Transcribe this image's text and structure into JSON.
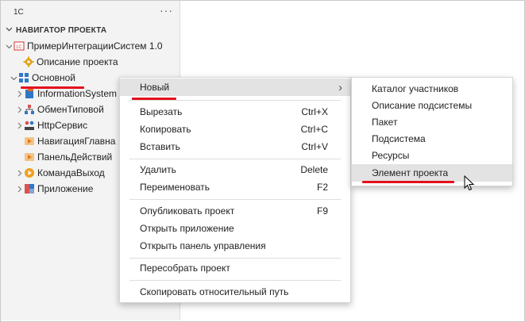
{
  "sidebar": {
    "header": "1C",
    "more": "···",
    "section_title": "НАВИГАТОР ПРОЕКТА",
    "tree": [
      {
        "label": "ПримерИнтеграцииСистем 1.0",
        "icon": "project-icon"
      },
      {
        "label": "Описание проекта",
        "icon": "gear-icon"
      },
      {
        "label": "Основной",
        "icon": "subsystem-grid-icon"
      },
      {
        "label": "InformationSystem",
        "icon": "information-system-icon"
      },
      {
        "label": "ОбменТиповой",
        "icon": "exchange-icon"
      },
      {
        "label": "HttpСервис",
        "icon": "http-service-icon"
      },
      {
        "label": "НавигацияГлавна",
        "icon": "navigation-icon"
      },
      {
        "label": "ПанельДействий",
        "icon": "action-panel-icon"
      },
      {
        "label": "КомандаВыход",
        "icon": "command-icon"
      },
      {
        "label": "Приложение",
        "icon": "application-icon"
      }
    ]
  },
  "context_menu": {
    "items": [
      {
        "label": "Новый",
        "shortcut": "›"
      },
      {
        "label": "Вырезать",
        "shortcut": "Ctrl+X"
      },
      {
        "label": "Копировать",
        "shortcut": "Ctrl+C"
      },
      {
        "label": "Вставить",
        "shortcut": "Ctrl+V"
      },
      {
        "label": "Удалить",
        "shortcut": "Delete"
      },
      {
        "label": "Переименовать",
        "shortcut": "F2"
      },
      {
        "label": "Опубликовать проект",
        "shortcut": "F9"
      },
      {
        "label": "Открыть приложение",
        "shortcut": ""
      },
      {
        "label": "Открыть панель управления",
        "shortcut": ""
      },
      {
        "label": "Пересобрать проект",
        "shortcut": ""
      },
      {
        "label": "Скопировать относительный путь",
        "shortcut": ""
      }
    ]
  },
  "submenu": {
    "items": [
      {
        "label": "Каталог участников"
      },
      {
        "label": "Описание подсистемы"
      },
      {
        "label": "Пакет"
      },
      {
        "label": "Подсистема"
      },
      {
        "label": "Ресурсы"
      },
      {
        "label": "Элемент проекта"
      }
    ]
  },
  "colors": {
    "accent_red": "#e4101b",
    "highlight": "#e3e3e3",
    "sidebar_bg": "#f3f3f3"
  }
}
